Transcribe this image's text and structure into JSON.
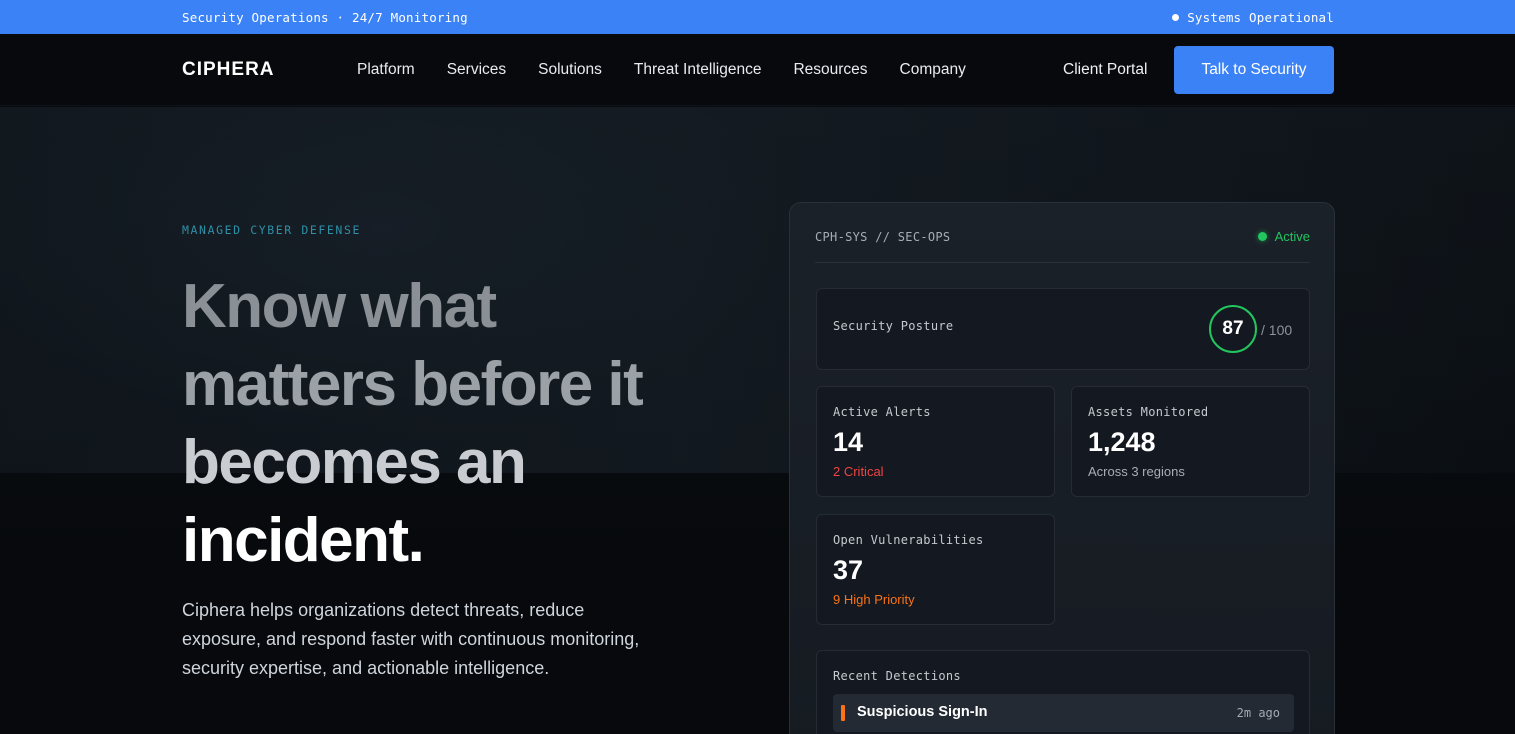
{
  "topbar": {
    "left_text": "Security Operations · 24/7 Monitoring",
    "status_text": "Systems Operational"
  },
  "nav": {
    "logo": "CIPHERA",
    "items": [
      "Platform",
      "Services",
      "Solutions",
      "Threat Intelligence",
      "Resources",
      "Company"
    ],
    "client_portal": "Client Portal",
    "cta": "Talk to Security"
  },
  "hero": {
    "eyebrow": "MANAGED CYBER DEFENSE",
    "headline": [
      "Know what",
      "matters before it",
      "becomes an",
      "incident."
    ],
    "lead": "Ciphera helps organizations detect threats, reduce exposure, and respond faster with continuous monitoring, security expertise, and actionable intelligence."
  },
  "panel": {
    "system_id": "CPH-SYS // SEC-OPS",
    "status": "Active",
    "posture": {
      "label": "Security Posture",
      "score": "87",
      "out_of": "/ 100"
    },
    "alerts": {
      "label": "Active Alerts",
      "value": "14",
      "sub": "2 Critical"
    },
    "assets": {
      "label": "Assets Monitored",
      "value": "1,248",
      "sub": "Across 3 regions"
    },
    "vulns": {
      "label": "Open Vulnerabilities",
      "value": "37",
      "sub": "9 High Priority"
    },
    "recent": {
      "label": "Recent Detections",
      "items": [
        {
          "title": "Suspicious Sign-In",
          "time": "2m ago"
        }
      ]
    }
  },
  "colors": {
    "accent": "#3b82f6",
    "success": "#22c55e",
    "critical": "#ef4444",
    "warning": "#f97316",
    "eyebrow": "#2f8fa7"
  }
}
